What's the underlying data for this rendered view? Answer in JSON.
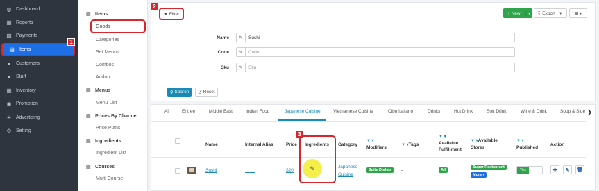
{
  "nav": {
    "items": [
      {
        "label": "Dashboard",
        "icon": "dashboard-icon"
      },
      {
        "label": "Reports",
        "icon": "reports-icon"
      },
      {
        "label": "Payments",
        "icon": "payments-icon"
      },
      {
        "label": "Items",
        "icon": "items-icon"
      },
      {
        "label": "Customers",
        "icon": "customers-icon"
      },
      {
        "label": "Staff",
        "icon": "staff-icon"
      },
      {
        "label": "Inventory",
        "icon": "inventory-icon"
      },
      {
        "label": "Promotion",
        "icon": "promotion-icon"
      },
      {
        "label": "Advertising",
        "icon": "advertising-icon"
      },
      {
        "label": "Setting",
        "icon": "setting-icon"
      }
    ],
    "active": "Items"
  },
  "subnav": {
    "sections": [
      {
        "title": "Items",
        "links": [
          "Goods",
          "Categories",
          "Set Menus",
          "Combos",
          "Addon"
        ]
      },
      {
        "title": "Menus",
        "links": [
          "Menu List"
        ]
      },
      {
        "title": "Prices By Channel",
        "links": [
          "Price Plans"
        ]
      },
      {
        "title": "Ingredients",
        "links": [
          "Ingredient List"
        ]
      },
      {
        "title": "Courses",
        "links": [
          "Multi Course"
        ]
      }
    ]
  },
  "toolbar": {
    "filter_label": "Filter",
    "new_label": "+ New",
    "export_label": "Export",
    "grid_label": "▦ ▾"
  },
  "form": {
    "name_label": "Name",
    "name_value": "Sushi",
    "code_label": "Code",
    "code_placeholder": "Code",
    "sku_label": "Sku",
    "sku_placeholder": "Sku",
    "search_label": "Search",
    "reset_label": "Reset"
  },
  "tabs": [
    "All",
    "Entree",
    "Middle East",
    "Indian Food",
    "Japanese Cuisine",
    "Vietnamese Cuisine",
    "Cibo Italiano",
    "Drinks",
    "Hot Drink",
    "Soft Drink",
    "Wine & Drink",
    "Soup & Side"
  ],
  "active_tab": "Japanese Cuisine",
  "table": {
    "headers": {
      "name": "Name",
      "alias": "Internal Alias",
      "price": "Price",
      "ingredients": "Ingredients",
      "category": "Category",
      "modifiers": "Modifiers",
      "tags": "Tags",
      "fulfillment_1": "Available",
      "fulfillment_2": "Fulfillment",
      "stores_1": "Available",
      "stores_2": "Stores",
      "published": "Published",
      "action": "Action"
    },
    "row": {
      "name": "Sushi",
      "alias": "____",
      "price": "$20",
      "category_1": "Japanese",
      "category_2": "Cuisine",
      "modifier": "Suite Dishes",
      "tags": "-",
      "fulfillment": "All",
      "store": "Super Restaurant",
      "more": "More ▾",
      "published": "Yes"
    }
  },
  "steps": [
    "1",
    "2",
    "3"
  ],
  "colors": {
    "accent": "#1e6fe6",
    "green": "#2fa44a",
    "red": "#d9262c",
    "teal": "#1a8ab5",
    "nav_bg": "#2f353e"
  }
}
